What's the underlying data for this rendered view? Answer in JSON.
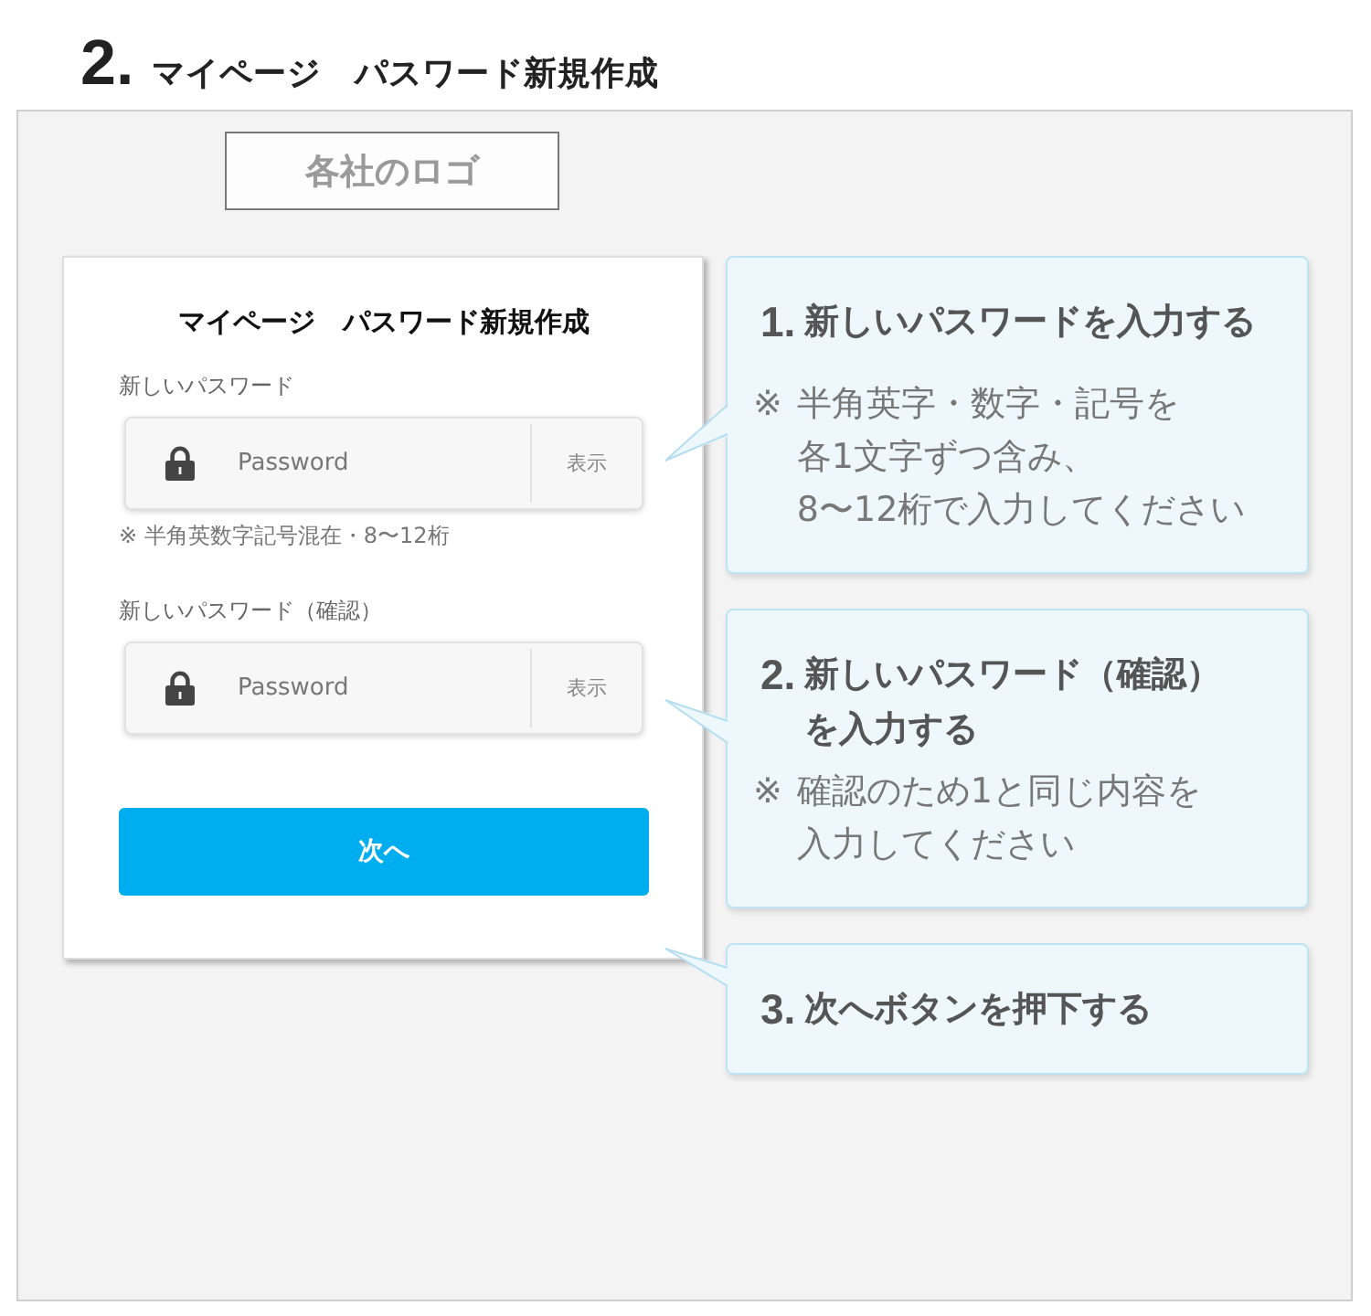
{
  "page_heading": {
    "number": "2.",
    "title": "マイページ　パスワード新規作成"
  },
  "logo_placeholder": "各社のロゴ",
  "form": {
    "title": "マイページ　パスワード新規作成",
    "fields": [
      {
        "label": "新しいパスワード",
        "placeholder": "Password",
        "toggle": "表示",
        "hint": "※ 半角英数字記号混在・8〜12桁"
      },
      {
        "label": "新しいパスワード（確認）",
        "placeholder": "Password",
        "toggle": "表示"
      }
    ],
    "submit_button": "次へ"
  },
  "callouts": [
    {
      "number": "1.",
      "title_lines": [
        "新しいパスワードを入力する"
      ],
      "note": {
        "mark": "※",
        "lines": [
          "半角英字・数字・記号を",
          "各1文字ずつ含み、",
          "8〜12桁で入力してください"
        ]
      }
    },
    {
      "number": "2.",
      "title_lines": [
        "新しいパスワード（確認）",
        "を入力する"
      ],
      "note": {
        "mark": "※",
        "lines": [
          "確認のため1と同じ内容を",
          "入力してください"
        ]
      }
    },
    {
      "number": "3.",
      "title_lines": [
        "次へボタンを押下する"
      ]
    }
  ]
}
